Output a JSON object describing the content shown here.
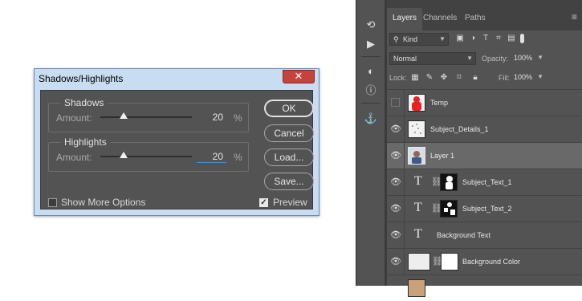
{
  "dialog": {
    "title": "Shadows/Highlights",
    "close_glyph": "✕",
    "shadows": {
      "legend": "Shadows",
      "amount_label": "Amount:",
      "value": "20",
      "unit": "%"
    },
    "highlights": {
      "legend": "Highlights",
      "amount_label": "Amount:",
      "value": "20",
      "unit": "%"
    },
    "buttons": {
      "ok": "OK",
      "cancel": "Cancel",
      "load": "Load...",
      "save": "Save..."
    },
    "show_more_options": {
      "label": "Show More Options",
      "checked": false
    },
    "preview": {
      "label": "Preview",
      "checked": true,
      "check_glyph": "✓"
    }
  },
  "toolbar": {
    "tools": [
      {
        "icon": "history-icon",
        "glyph": "⟲"
      },
      {
        "icon": "play-icon",
        "glyph": "▶"
      },
      {
        "icon": "adjustments-icon",
        "glyph": "◐"
      },
      {
        "icon": "info-icon",
        "glyph": "ⓘ"
      },
      {
        "icon": "clone-source-icon",
        "glyph": "⚓"
      }
    ]
  },
  "layers_panel": {
    "tabs": [
      "Layers",
      "Channels",
      "Paths"
    ],
    "active_tab": "Layers",
    "menu_glyph": "≡",
    "filter": {
      "label": "Kind",
      "search_glyph": "⚲"
    },
    "blend_mode": "Normal",
    "opacity": {
      "label": "Opacity:",
      "value": "100%"
    },
    "lock": {
      "label": "Lock:"
    },
    "fill": {
      "label": "Fill:",
      "value": "100%"
    },
    "layers": [
      {
        "name": "Temp",
        "visible": false,
        "kind": "image",
        "thumb_color": "#e82020"
      },
      {
        "name": "Subject_Details_1",
        "visible": true,
        "kind": "image",
        "thumb_color": "#f2f2f2"
      },
      {
        "name": "Layer 1",
        "visible": true,
        "kind": "image",
        "thumb_color": "#d9dde6",
        "selected": true
      },
      {
        "name": "Subject_Text_1",
        "visible": true,
        "kind": "text-masked"
      },
      {
        "name": "Subject_Text_2",
        "visible": true,
        "kind": "text-masked"
      },
      {
        "name": "Background Text",
        "visible": true,
        "kind": "text"
      },
      {
        "name": "Background Color",
        "visible": true,
        "kind": "fill-masked",
        "thumb_color": "#eeeeee"
      }
    ]
  }
}
